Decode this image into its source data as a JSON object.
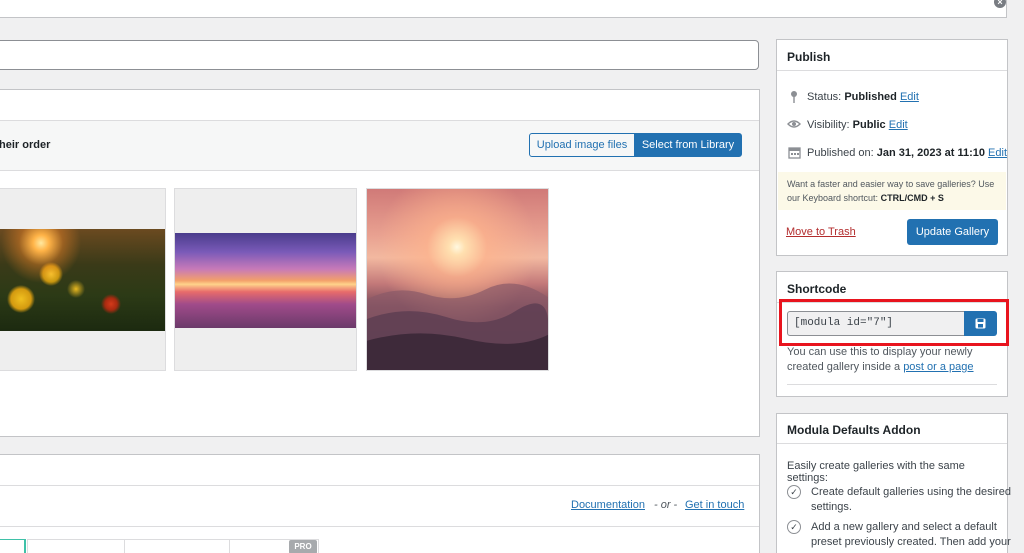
{
  "gallery": {
    "order_text": "heir order",
    "upload_label": "Upload image files",
    "library_label": "Select from Library"
  },
  "settings": {
    "documentation_label": "Documentation",
    "or_label": "- or -",
    "contact_label": "Get in touch",
    "pro_badge": "PRO"
  },
  "publish": {
    "title": "Publish",
    "status_label": "Status:",
    "status_value": "Published",
    "visibility_label": "Visibility:",
    "visibility_value": "Public",
    "published_label": "Published on:",
    "published_value": "Jan 31, 2023 at 11:10",
    "edit_label": "Edit",
    "tip_text": "Want a faster and easier way to save galleries? Use our Keyboard shortcut:",
    "tip_shortcut": "CTRL/CMD + S",
    "trash_label": "Move to Trash",
    "update_label": "Update Gallery"
  },
  "shortcode": {
    "title": "Shortcode",
    "value": "[modula id=\"7\"]",
    "help_text": "You can use this to display your newly created gallery inside a",
    "help_link": "post or a page"
  },
  "addon": {
    "title": "Modula Defaults Addon",
    "intro": "Easily create galleries with the same settings:",
    "items": [
      "Create default galleries using the desired settings.",
      "Add a new gallery and select a default preset previously created. Then add your"
    ]
  }
}
